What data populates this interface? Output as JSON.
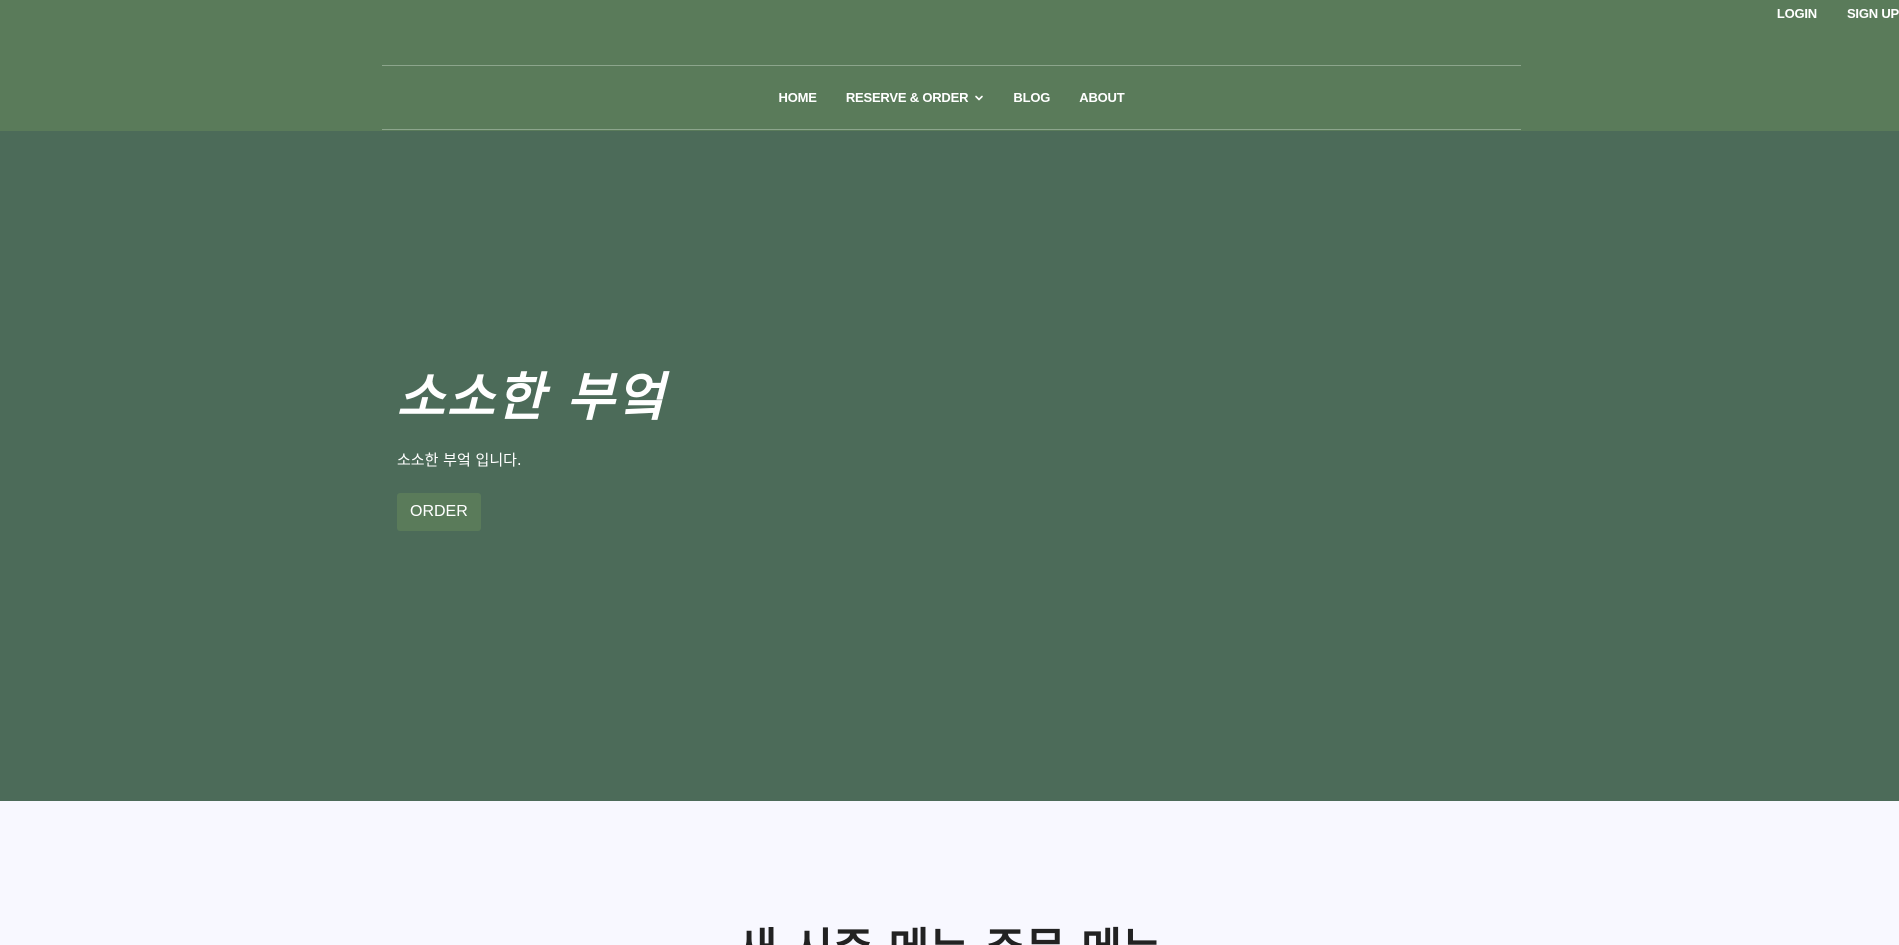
{
  "header": {
    "top_links": {
      "login": "LOGIN",
      "signup": "SIGN UP"
    },
    "nav": [
      {
        "label": "HOME"
      },
      {
        "label": "RESERVE & ORDER",
        "has_dropdown": true
      },
      {
        "label": "BLOG"
      },
      {
        "label": "ABOUT"
      }
    ]
  },
  "hero": {
    "title": "소소한 부엌",
    "subtitle": "소소한 부엌 입니다.",
    "order_button": "ORDER"
  },
  "section": {
    "heading": "새 시즌 메뉴 주문 메뉴"
  },
  "colors": {
    "header_bg": "#5a7b5a",
    "hero_bg": "#4c6b59",
    "page_bg": "#f8f8ff",
    "button_bg": "#5a7b5a"
  },
  "icons": {
    "dropdown": "chevron-down-icon"
  }
}
